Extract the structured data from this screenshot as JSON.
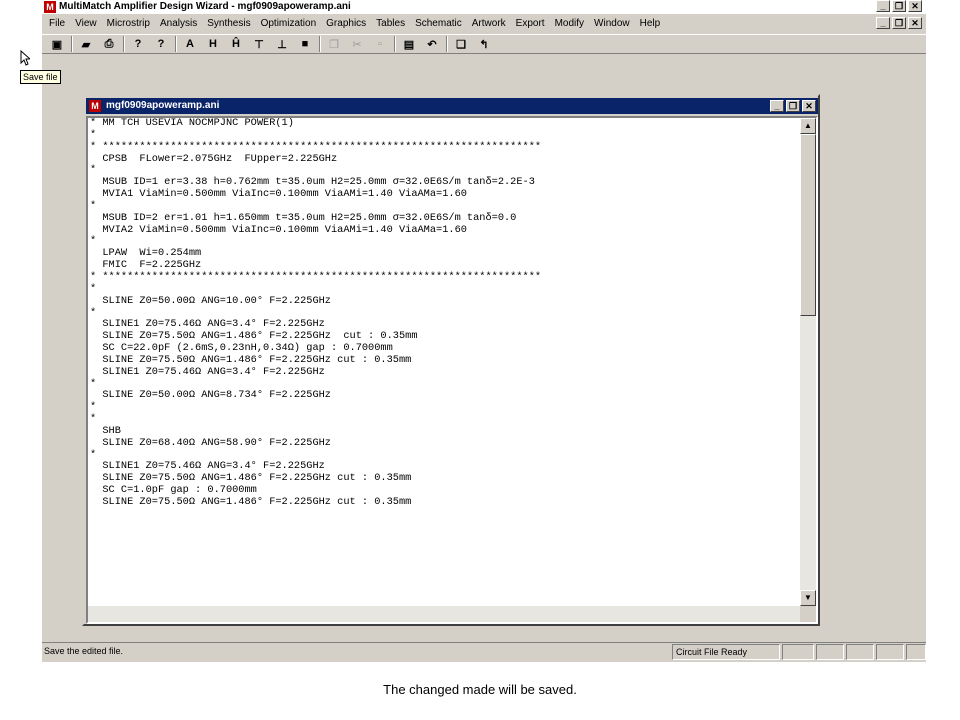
{
  "app": {
    "title": "MultiMatch Amplifier Design Wizard - mgf0909apoweramp.ani",
    "logo_letter": "M",
    "accent_color": "#0a246a",
    "logo_color": "#c00000"
  },
  "window_controls": {
    "minimize": "_",
    "restore": "❐",
    "close": "✕"
  },
  "menu": [
    "File",
    "View",
    "Microstrip",
    "Analysis",
    "Synthesis",
    "Optimization",
    "Graphics",
    "Tables",
    "Schematic",
    "Artwork",
    "Export",
    "Modify",
    "Window",
    "Help"
  ],
  "toolbar": [
    {
      "icon": "save-icon",
      "glyph": "▣",
      "enabled": true
    },
    {
      "icon": "open-icon",
      "glyph": "▰",
      "enabled": true
    },
    {
      "icon": "print-icon",
      "glyph": "⎙",
      "enabled": true
    },
    {
      "icon": "help-icon",
      "glyph": "?",
      "enabled": true
    },
    {
      "icon": "context-help-icon",
      "glyph": "?",
      "enabled": true
    },
    {
      "icon": "draw-icon",
      "glyph": "A",
      "enabled": true
    },
    {
      "icon": "component-a-icon",
      "glyph": "H",
      "enabled": true
    },
    {
      "icon": "component-b-icon",
      "glyph": "Ĥ",
      "enabled": true
    },
    {
      "icon": "stub-icon",
      "glyph": "⊤",
      "enabled": true
    },
    {
      "icon": "ground-icon",
      "glyph": "⊥",
      "enabled": true
    },
    {
      "icon": "stop-icon",
      "glyph": "■",
      "enabled": true
    },
    {
      "icon": "copy-icon",
      "glyph": "❐",
      "enabled": false
    },
    {
      "icon": "cut-icon",
      "glyph": "✂",
      "enabled": false
    },
    {
      "icon": "paste-icon",
      "glyph": "▫",
      "enabled": false
    },
    {
      "icon": "clipboard-icon",
      "glyph": "▤",
      "enabled": true
    },
    {
      "icon": "undo-icon",
      "glyph": "↶",
      "enabled": true
    },
    {
      "icon": "window-icon",
      "glyph": "❏",
      "enabled": true
    },
    {
      "icon": "tool-icon",
      "glyph": "↰",
      "enabled": true
    }
  ],
  "tooltip": "Save file",
  "document": {
    "title": "mgf0909apoweramp.ani",
    "lines": [
      "* MM TCH USEVIA NOCMPJNC POWER(1)",
      "*",
      "* ***********************************************************************",
      "  CPSB  FLower=2.075GHz  FUpper=2.225GHz",
      "*",
      "  MSUB ID=1 er=3.38 h=0.762mm t=35.0um H2=25.0mm σ=32.0E6S/m tanδ=2.2E-3",
      "  MVIA1 ViaMin=0.500mm ViaInc=0.100mm ViaAMi=1.40 ViaAMa=1.60",
      "*",
      "  MSUB ID=2 er=1.01 h=1.650mm t=35.0um H2=25.0mm σ=32.0E6S/m tanδ=0.0",
      "  MVIA2 ViaMin=0.500mm ViaInc=0.100mm ViaAMi=1.40 ViaAMa=1.60",
      "*",
      "  LPAW  Wi=0.254mm",
      "  FMIC  F=2.225GHz",
      "* ***********************************************************************",
      "*",
      "  SLINE Z0=50.00Ω ANG=10.00° F=2.225GHz",
      "*",
      "  SLINE1 Z0=75.46Ω ANG=3.4° F=2.225GHz",
      "  SLINE Z0=75.50Ω ANG=1.486° F=2.225GHz  cut : 0.35mm",
      "  SC C=22.0pF (2.6mS,0.23nH,0.34Ω) gap : 0.7000mm",
      "  SLINE Z0=75.50Ω ANG=1.486° F=2.225GHz cut : 0.35mm",
      "  SLINE1 Z0=75.46Ω ANG=3.4° F=2.225GHz",
      "*",
      "  SLINE Z0=50.00Ω ANG=8.734° F=2.225GHz",
      "*",
      "*",
      "  SHB",
      "  SLINE Z0=68.40Ω ANG=58.90° F=2.225GHz",
      "*",
      "  SLINE1 Z0=75.46Ω ANG=3.4° F=2.225GHz",
      "  SLINE Z0=75.50Ω ANG=1.486° F=2.225GHz cut : 0.35mm",
      "  SC C=1.0pF gap : 0.7000mm",
      "  SLINE Z0=75.50Ω ANG=1.486° F=2.225GHz cut : 0.35mm"
    ]
  },
  "scrollbar": {
    "up": "▲",
    "down": "▼",
    "vertical_position": 0.0,
    "vertical_thumb_fraction": 0.4
  },
  "statusbar": {
    "message": "Save the edited file.",
    "circuit_status": "Circuit File Ready"
  },
  "caption": "The changed made will be saved."
}
